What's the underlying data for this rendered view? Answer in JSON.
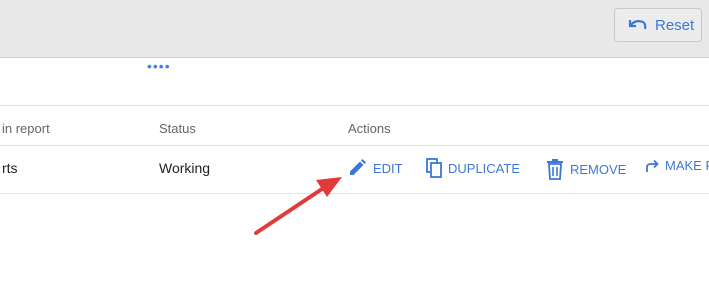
{
  "toolbar": {
    "reset_label": "Reset"
  },
  "tabs": {
    "overflow": "••••"
  },
  "table": {
    "columns": [
      "in report",
      "Status",
      "Actions"
    ],
    "row": {
      "name": "rts",
      "status": "Working",
      "actions": {
        "edit": "EDIT",
        "duplicate": "DUPLICATE",
        "remove": "REMOVE",
        "make": "MAKE R"
      }
    }
  },
  "colors": {
    "accent": "#3b78d8",
    "annotation_arrow": "#e03a3a"
  },
  "icons": {
    "reset": "undo-icon",
    "edit": "pencil-icon",
    "duplicate": "copy-icon",
    "remove": "trash-icon",
    "make": "share-arrow-icon"
  }
}
